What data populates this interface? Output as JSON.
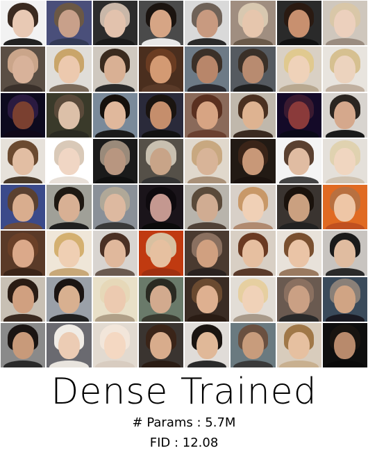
{
  "title": "Dense Trained",
  "params_text": "# Params : 5.7M",
  "fid_text": "FID : 12.08",
  "grid": {
    "rows": 8,
    "cols": 8,
    "tiles": [
      {
        "bg": "#f2f2f2",
        "hair": "#3a2a20",
        "skin": "#e8c9b4",
        "cloth": "#222222"
      },
      {
        "bg": "#4a4f7a",
        "hair": "#6b5845",
        "skin": "#c8a08a",
        "cloth": "#333a55"
      },
      {
        "bg": "#2c2c2c",
        "hair": "#c9b7a8",
        "skin": "#e2c2ad",
        "cloth": "#1a1a1a"
      },
      {
        "bg": "#4a4a4a",
        "hair": "#1b1410",
        "skin": "#d6a585",
        "cloth": "#e8e8e8"
      },
      {
        "bg": "#d9d9d9",
        "hair": "#6f6258",
        "skin": "#c89a80",
        "cloth": "#2b2b2b"
      },
      {
        "bg": "#a08e80",
        "hair": "#d8c8b0",
        "skin": "#e6c6ad",
        "cloth": "#6a5a4a"
      },
      {
        "bg": "#2a2a2a",
        "hair": "#2a1a12",
        "skin": "#c8906f",
        "cloth": "#111111"
      },
      {
        "bg": "#cfc7bd",
        "hair": "#d9c7a8",
        "skin": "#ecd0bd",
        "cloth": "#9a8c80"
      },
      {
        "bg": "#5a4e44",
        "hair": "#caa58a",
        "skin": "#d8b29a",
        "cloth": "#3a302a"
      },
      {
        "bg": "#e0ddd8",
        "hair": "#c9a56a",
        "skin": "#ecc9ae",
        "cloth": "#7a6a5a"
      },
      {
        "bg": "#cfc8bf",
        "hair": "#3a2a1e",
        "skin": "#d9b094",
        "cloth": "#2a2a2a"
      },
      {
        "bg": "#4a2e1e",
        "hair": "#6a3c22",
        "skin": "#d39a73",
        "cloth": "#5a3a28"
      },
      {
        "bg": "#6d7a86",
        "hair": "#3b3028",
        "skin": "#b8866a",
        "cloth": "#2a2a30"
      },
      {
        "bg": "#555a60",
        "hair": "#3a3028",
        "skin": "#b88b70",
        "cloth": "#202020"
      },
      {
        "bg": "#d9d0c4",
        "hair": "#e0c98f",
        "skin": "#efd2b9",
        "cloth": "#b8a890"
      },
      {
        "bg": "#e8e4de",
        "hair": "#d6c090",
        "skin": "#ecd3be",
        "cloth": "#c0b0a0"
      },
      {
        "bg": "#0d0a1e",
        "hair": "#2a1a40",
        "skin": "#7a4030",
        "cloth": "#100818"
      },
      {
        "bg": "#3a3a2a",
        "hair": "#5a4a3a",
        "skin": "#dcc0a8",
        "cloth": "#2a2a22"
      },
      {
        "bg": "#7a8a9a",
        "hair": "#15100c",
        "skin": "#e0b89c",
        "cloth": "#1a1a1a"
      },
      {
        "bg": "#2a2a3a",
        "hair": "#1a1410",
        "skin": "#c58e6c",
        "cloth": "#111111"
      },
      {
        "bg": "#8a6a5a",
        "hair": "#5a3020",
        "skin": "#d7a483",
        "cloth": "#6a4030"
      },
      {
        "bg": "#c0b8ac",
        "hair": "#4a3020",
        "skin": "#deb391",
        "cloth": "#3a2a20"
      },
      {
        "bg": "#140a28",
        "hair": "#3a1a30",
        "skin": "#8a3a3a",
        "cloth": "#0a0a18"
      },
      {
        "bg": "#d8d4cf",
        "hair": "#2b2520",
        "skin": "#d5a88c",
        "cloth": "#1a1a1a"
      },
      {
        "bg": "#e6e1da",
        "hair": "#6b4a30",
        "skin": "#e2bea3",
        "cloth": "#4a3a2a"
      },
      {
        "bg": "#ffffff",
        "hair": "#d9c9b8",
        "skin": "#f0d6c4",
        "cloth": "#e8e0d8"
      },
      {
        "bg": "#1a1a1a",
        "hair": "#9a8a7a",
        "skin": "#b89680",
        "cloth": "#0f0f0f"
      },
      {
        "bg": "#555048",
        "hair": "#c8c0b0",
        "skin": "#c8a488",
        "cloth": "#333333"
      },
      {
        "bg": "#e0d8cc",
        "hair": "#c8a880",
        "skin": "#d8b498",
        "cloth": "#a89078"
      },
      {
        "bg": "#221a14",
        "hair": "#3a2418",
        "skin": "#c89878",
        "cloth": "#1a120e"
      },
      {
        "bg": "#f4f4f4",
        "hair": "#5a4030",
        "skin": "#e0bca2",
        "cloth": "#444444"
      },
      {
        "bg": "#e4e0da",
        "hair": "#e0d2b0",
        "skin": "#f0d6c0",
        "cloth": "#cfc2b0"
      },
      {
        "bg": "#3b4a8a",
        "hair": "#5a4030",
        "skin": "#d9ad8e",
        "cloth": "#6b4a3a"
      },
      {
        "bg": "#a0a098",
        "hair": "#1e1812",
        "skin": "#d8b094",
        "cloth": "#202020"
      },
      {
        "bg": "#8a9098",
        "hair": "#b0a898",
        "skin": "#ddb9a0",
        "cloth": "#3a3a3a"
      },
      {
        "bg": "#1a141a",
        "hair": "#0e0a0e",
        "skin": "#c49890",
        "cloth": "#0a0a0a"
      },
      {
        "bg": "#b8b4ac",
        "hair": "#5a4a3a",
        "skin": "#d0ac92",
        "cloth": "#504238"
      },
      {
        "bg": "#d8d0c8",
        "hair": "#c89868",
        "skin": "#f0d0b6",
        "cloth": "#b08a70"
      },
      {
        "bg": "#3a3430",
        "hair": "#1a120c",
        "skin": "#caa080",
        "cloth": "#222222"
      },
      {
        "bg": "#e06a22",
        "hair": "#b87040",
        "skin": "#eec6a6",
        "cloth": "#c05020"
      },
      {
        "bg": "#5a3a28",
        "hair": "#6a4028",
        "skin": "#dba98a",
        "cloth": "#3a2418"
      },
      {
        "bg": "#efe6d8",
        "hair": "#d4b070",
        "skin": "#efcfb3",
        "cloth": "#c8a878"
      },
      {
        "bg": "#d8d4d0",
        "hair": "#4a3024",
        "skin": "#e0b89c",
        "cloth": "#6a5a50"
      },
      {
        "bg": "#c03a10",
        "hair": "#d8c0a0",
        "skin": "#e6c0a0",
        "cloth": "#a03010"
      },
      {
        "bg": "#4a3a30",
        "hair": "#8a7060",
        "skin": "#d0a080",
        "cloth": "#2a2220"
      },
      {
        "bg": "#d8cfc4",
        "hair": "#6a3a22",
        "skin": "#e6bfa0",
        "cloth": "#5a3a2a"
      },
      {
        "bg": "#e8e2da",
        "hair": "#7a5030",
        "skin": "#eac4a6",
        "cloth": "#9a7a60"
      },
      {
        "bg": "#c8c4c0",
        "hair": "#1a1a1a",
        "skin": "#e0bca0",
        "cloth": "#2a2a2a"
      },
      {
        "bg": "#c8c0b4",
        "hair": "#2a1c14",
        "skin": "#d0a080",
        "cloth": "#3a2a20"
      },
      {
        "bg": "#9aa0a8",
        "hair": "#1a1412",
        "skin": "#d8b090",
        "cloth": "#202020"
      },
      {
        "bg": "#e8e0c8",
        "hair": "#e6d8b8",
        "skin": "#eccab0",
        "cloth": "#b0a088"
      },
      {
        "bg": "#6a7a6a",
        "hair": "#2a2a22",
        "skin": "#d2aa8e",
        "cloth": "#3a3a30"
      },
      {
        "bg": "#3a2c24",
        "hair": "#6a4a30",
        "skin": "#deb090",
        "cloth": "#2a1c14"
      },
      {
        "bg": "#e2ddd6",
        "hair": "#e6cfa0",
        "skin": "#f0d2b8",
        "cloth": "#a89a8a"
      },
      {
        "bg": "#6a5a50",
        "hair": "#8a7060",
        "skin": "#caa084",
        "cloth": "#2a2a2a"
      },
      {
        "bg": "#3a4a5a",
        "hair": "#8a8078",
        "skin": "#d0a484",
        "cloth": "#1a1a22"
      },
      {
        "bg": "#8a8a8a",
        "hair": "#1a1412",
        "skin": "#c89a7a",
        "cloth": "#2a2a2a"
      },
      {
        "bg": "#6a6a70",
        "hair": "#f0ece6",
        "skin": "#ecccb4",
        "cloth": "#e8e4de"
      },
      {
        "bg": "#e2dad0",
        "hair": "#f2e6da",
        "skin": "#f4d8c2",
        "cloth": "#d8ccc0"
      },
      {
        "bg": "#3a3430",
        "hair": "#3a2418",
        "skin": "#d8ac8c",
        "cloth": "#2a1c14"
      },
      {
        "bg": "#e0dcd8",
        "hair": "#1a1410",
        "skin": "#e0b898",
        "cloth": "#2a2a2a"
      },
      {
        "bg": "#6a7a80",
        "hair": "#6a5040",
        "skin": "#c89c7c",
        "cloth": "#3a3a3a"
      },
      {
        "bg": "#d8ccbc",
        "hair": "#a07848",
        "skin": "#e6c0a0",
        "cloth": "#c8b090"
      },
      {
        "bg": "#0e0e0e",
        "hair": "#181410",
        "skin": "#b88a6c",
        "cloth": "#0a0a0a"
      }
    ]
  }
}
